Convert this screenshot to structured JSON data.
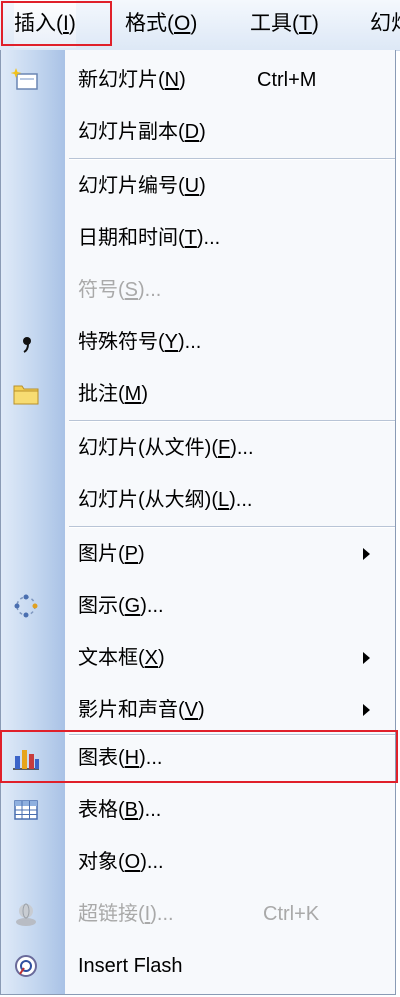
{
  "menubar": {
    "items": [
      {
        "label": "插入(I)",
        "mnemonic": "I"
      },
      {
        "label": "格式(O)",
        "mnemonic": "O"
      },
      {
        "label": "工具(T)",
        "mnemonic": "T"
      },
      {
        "label": "幻灯"
      }
    ],
    "active_index": 0
  },
  "menu": {
    "items": [
      {
        "label": "新幻灯片(N)",
        "shortcut": "Ctrl+M",
        "icon": "new-slide-icon"
      },
      {
        "label": "幻灯片副本(D)"
      },
      {
        "label": "幻灯片编号(U)"
      },
      {
        "label": "日期和时间(T)..."
      },
      {
        "label": "符号(S)...",
        "disabled": true
      },
      {
        "label": "特殊符号(Y)...",
        "icon": "special-symbol-icon"
      },
      {
        "label": "批注(M)",
        "icon": "comment-icon"
      },
      {
        "label": "幻灯片(从文件)(F)..."
      },
      {
        "label": "幻灯片(从大纲)(L)..."
      },
      {
        "label": "图片(P)",
        "submenu": true
      },
      {
        "label": "图示(G)...",
        "icon": "diagram-icon"
      },
      {
        "label": "文本框(X)",
        "submenu": true
      },
      {
        "label": "影片和声音(V)",
        "submenu": true
      },
      {
        "label": "图表(H)...",
        "icon": "chart-icon",
        "highlighted": true
      },
      {
        "label": "表格(B)...",
        "icon": "table-icon"
      },
      {
        "label": "对象(O)..."
      },
      {
        "label": "超链接(I)...",
        "shortcut": "Ctrl+K",
        "disabled": true,
        "icon": "hyperlink-icon"
      },
      {
        "label": "Insert Flash",
        "icon": "flash-icon"
      }
    ]
  },
  "colors": {
    "highlight_border": "#e0202a",
    "disabled_text": "#a9a9a9",
    "icon_strip": "#c3d6ef"
  }
}
